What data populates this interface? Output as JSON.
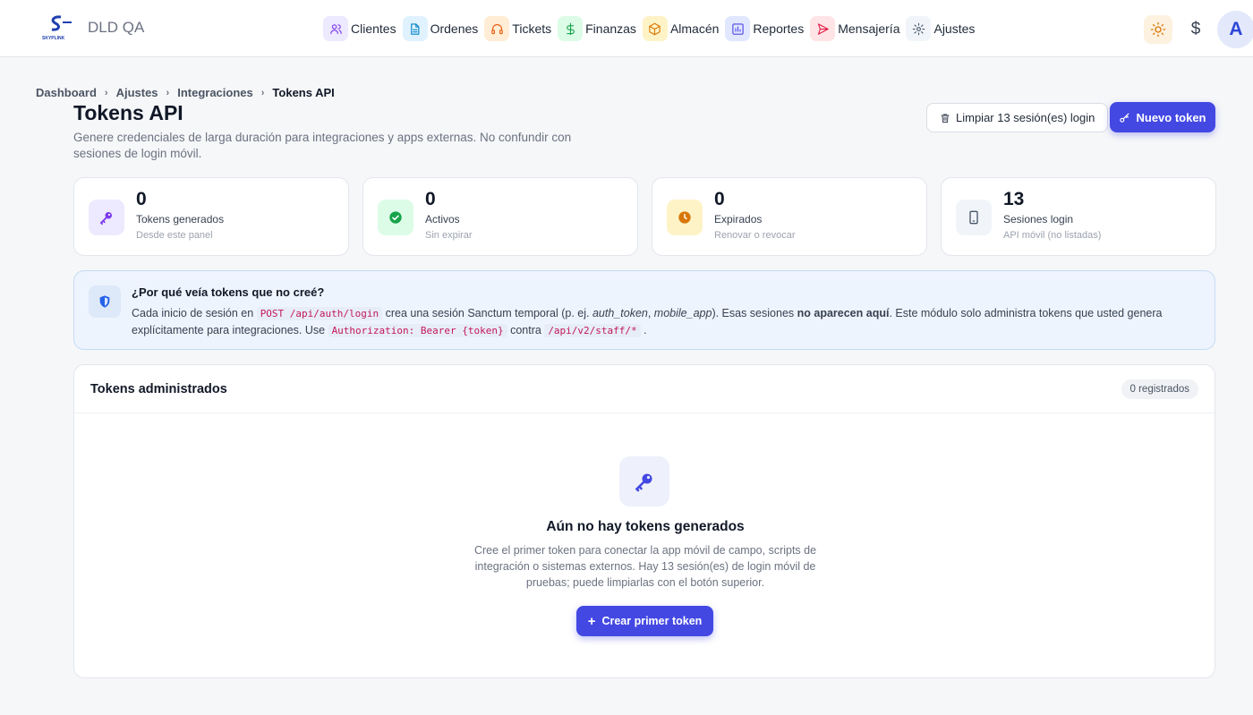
{
  "app": {
    "brand": "DLD QA",
    "logo_text": "SKYPLINK"
  },
  "nav": [
    {
      "label": "Clientes",
      "icon": "users-icon",
      "bg": "#ede9fe",
      "color": "#7c3aed"
    },
    {
      "label": "Ordenes",
      "icon": "document-icon",
      "bg": "#e0f2fe",
      "color": "#0284c7"
    },
    {
      "label": "Tickets",
      "icon": "headset-icon",
      "bg": "#ffedd5",
      "color": "#ea580c"
    },
    {
      "label": "Finanzas",
      "icon": "dollar-icon",
      "bg": "#dcfce7",
      "color": "#16a34a"
    },
    {
      "label": "Almacén",
      "icon": "box-icon",
      "bg": "#fef3c7",
      "color": "#d97706"
    },
    {
      "label": "Reportes",
      "icon": "chart-icon",
      "bg": "#e0e7ff",
      "color": "#4f46e5"
    },
    {
      "label": "Mensajería",
      "icon": "send-icon",
      "bg": "#ffe4e6",
      "color": "#e11d48"
    },
    {
      "label": "Ajustes",
      "icon": "gear-icon",
      "bg": "#f1f5f9",
      "color": "#475569"
    }
  ],
  "topbar": {
    "currency_symbol": "$",
    "avatar_initial": "A"
  },
  "breadcrumb": [
    "Dashboard",
    "Ajustes",
    "Integraciones",
    "Tokens API"
  ],
  "page": {
    "title": "Tokens API",
    "description": "Genere credenciales de larga duración para integraciones y apps externas. No confundir con sesiones de login móvil.",
    "clear_button": "Limpiar 13 sesión(es) login",
    "new_button": "Nuevo token"
  },
  "stats": [
    {
      "value": "0",
      "label": "Tokens generados",
      "sub": "Desde este panel",
      "icon": "key-icon",
      "bg": "#ede9fe",
      "color": "#7c3aed"
    },
    {
      "value": "0",
      "label": "Activos",
      "sub": "Sin expirar",
      "icon": "check-circle-icon",
      "bg": "#dcfce7",
      "color": "#16a34a"
    },
    {
      "value": "0",
      "label": "Expirados",
      "sub": "Renovar o revocar",
      "icon": "clock-icon",
      "bg": "#fef3c7",
      "color": "#d97706"
    },
    {
      "value": "13",
      "label": "Sesiones login",
      "sub": "API móvil (no listadas)",
      "icon": "phone-icon",
      "bg": "#f1f5f9",
      "color": "#475569"
    }
  ],
  "info": {
    "title": "¿Por qué veía tokens que no creé?",
    "t1": "Cada inicio de sesión en ",
    "code1": "POST /api/auth/login",
    "t2": " crea una sesión Sanctum temporal (p. ej. ",
    "em1": "auth_token",
    "t3": ", ",
    "em2": "mobile_app",
    "t4": "). Esas sesiones ",
    "strong1": "no aparecen aquí",
    "t5": ". Este módulo solo administra tokens que usted genera explícitamente para integraciones. Use ",
    "code2": "Authorization: Bearer {token}",
    "t6": " contra ",
    "code3": "/api/v2/staff/*",
    "t7": " ."
  },
  "tokens": {
    "title": "Tokens administrados",
    "count_badge": "0 registrados",
    "empty_title": "Aún no hay tokens generados",
    "empty_desc": "Cree el primer token para conectar la app móvil de campo, scripts de integración o sistemas externos. Hay 13 sesión(es) de login móvil de pruebas; puede limpiarlas con el botón superior.",
    "create_button": "Crear primer token"
  }
}
